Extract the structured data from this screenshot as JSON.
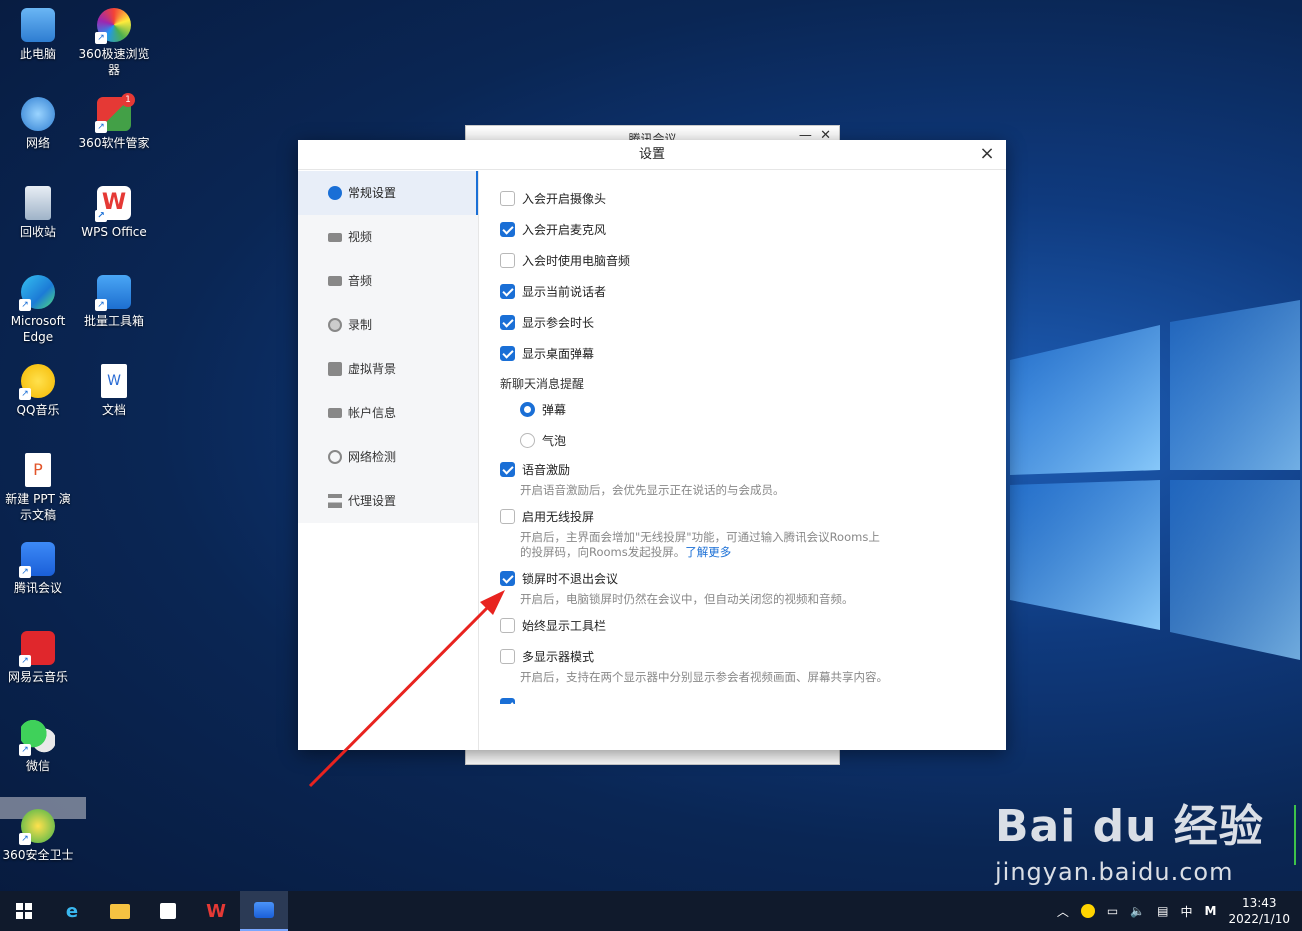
{
  "desktop": {
    "icons": [
      {
        "label": "此电脑"
      },
      {
        "label": "360极速浏览器"
      },
      {
        "label": "网络"
      },
      {
        "label": "360软件管家",
        "badge": "1"
      },
      {
        "label": "回收站"
      },
      {
        "label": "WPS Office"
      },
      {
        "label": "Microsoft Edge"
      },
      {
        "label": "批量工具箱"
      },
      {
        "label": "QQ音乐"
      },
      {
        "label": "文档"
      },
      {
        "label": "新建 PPT 演示文稿"
      },
      {
        "label": "腾讯会议"
      },
      {
        "label": "网易云音乐"
      },
      {
        "label": "微信"
      },
      {
        "label": "360安全卫士"
      }
    ]
  },
  "background_window": {
    "title": "腾讯会议"
  },
  "dialog": {
    "title": "设置",
    "close": "×",
    "nav": [
      {
        "label": "常规设置",
        "active": true
      },
      {
        "label": "视频"
      },
      {
        "label": "音频"
      },
      {
        "label": "录制"
      },
      {
        "label": "虚拟背景"
      },
      {
        "label": "帐户信息"
      },
      {
        "label": "网络检测"
      },
      {
        "label": "代理设置"
      }
    ],
    "options": {
      "camera": {
        "label": "入会开启摄像头",
        "checked": false
      },
      "mic": {
        "label": "入会开启麦克风",
        "checked": true
      },
      "pc_audio": {
        "label": "入会时使用电脑音频",
        "checked": false
      },
      "speaker": {
        "label": "显示当前说话者",
        "checked": true
      },
      "duration": {
        "label": "显示参会时长",
        "checked": true
      },
      "popup": {
        "label": "显示桌面弹幕",
        "checked": true
      },
      "chat_section": "新聊天消息提醒",
      "radio_danmu": {
        "label": "弹幕",
        "checked": true
      },
      "radio_bubble": {
        "label": "气泡",
        "checked": false
      },
      "voice": {
        "label": "语音激励",
        "checked": true,
        "desc": "开启语音激励后，会优先显示正在说话的与会成员。"
      },
      "wireless": {
        "label": "启用无线投屏",
        "checked": false,
        "desc1": "开启后，主界面会增加\"无线投屏\"功能，可通过输入腾讯会议Rooms上",
        "desc2": "的投屏码，向Rooms发起投屏。",
        "link": "了解更多"
      },
      "lock": {
        "label": "锁屏时不退出会议",
        "checked": true,
        "desc": "开启后，电脑锁屏时仍然在会议中，但自动关闭您的视频和音频。"
      },
      "toolbar": {
        "label": "始终显示工具栏",
        "checked": false
      },
      "multi": {
        "label": "多显示器模式",
        "checked": false,
        "desc": "开启后，支持在两个显示器中分别显示参会者视频画面、屏幕共享内容。"
      }
    }
  },
  "watermark": {
    "brand": "Bai du 经验",
    "url": "jingyan.baidu.com"
  },
  "taskbar": {
    "time": "13:43",
    "date": "2022/1/10",
    "ime": "中",
    "ime2": "M"
  }
}
